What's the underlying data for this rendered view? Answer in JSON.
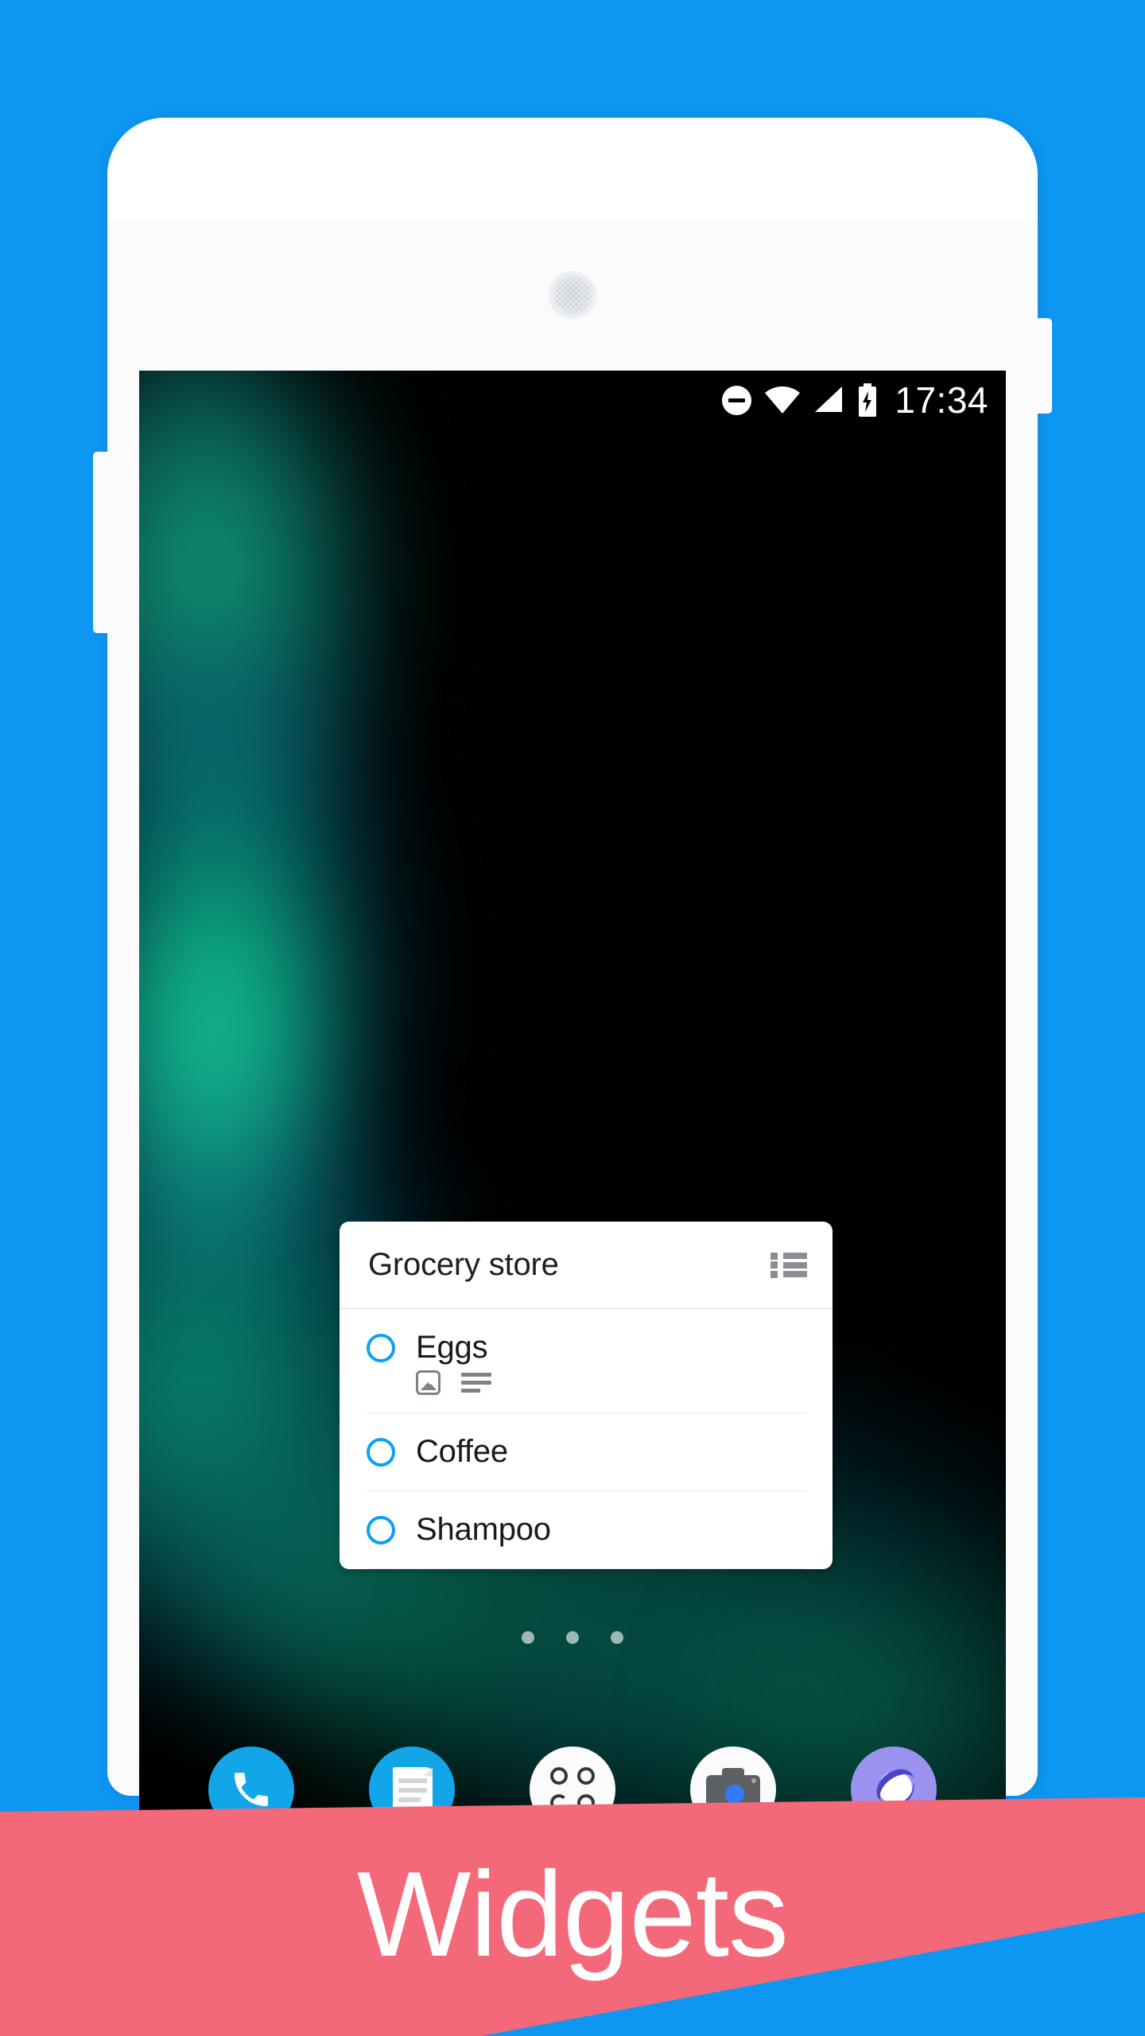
{
  "theme": {
    "page_background": "#0d97f2",
    "banner_color": "#f4697a",
    "accent_blue": "#0aa2f0",
    "device_body": "#fbfbfb",
    "screen_background": "#000000"
  },
  "status_bar": {
    "clock": "17:34",
    "icons": [
      {
        "name": "do-not-disturb-icon",
        "label": "Do not disturb"
      },
      {
        "name": "wifi-icon",
        "label": "Wi-Fi"
      },
      {
        "name": "cellular-signal-icon",
        "label": "Signal"
      },
      {
        "name": "battery-charging-icon",
        "label": "Battery charging"
      }
    ]
  },
  "widget": {
    "title": "Grocery store",
    "menu_icon": "list-view-icon",
    "items": [
      {
        "label": "Eggs",
        "checked": false,
        "attachments": [
          {
            "name": "photo-attachment-icon",
            "label": "Photo"
          },
          {
            "name": "note-attachment-icon",
            "label": "Note"
          }
        ]
      },
      {
        "label": "Coffee",
        "checked": false,
        "attachments": []
      },
      {
        "label": "Shampoo",
        "checked": false,
        "attachments": []
      }
    ]
  },
  "home_screen": {
    "page_dots": 3,
    "current_page": 2,
    "dock": [
      {
        "name": "phone-app-icon",
        "label": "Phone",
        "color": "#12a6e8"
      },
      {
        "name": "messages-app-icon",
        "label": "Messages",
        "color": "#12a6e8"
      },
      {
        "name": "app-drawer-icon",
        "label": "All apps",
        "color": "#fbfbfb"
      },
      {
        "name": "camera-app-icon",
        "label": "Camera",
        "color": "#fbfbfb"
      },
      {
        "name": "browser-app-icon",
        "label": "Browser",
        "color": "#9b92f0"
      }
    ]
  },
  "banner": {
    "text": "Widgets"
  },
  "device": {
    "speaker": "earpiece-speaker-grille",
    "buttons": [
      {
        "name": "volume-rocker-button",
        "label": "Volume"
      },
      {
        "name": "power-button",
        "label": "Power"
      }
    ]
  }
}
